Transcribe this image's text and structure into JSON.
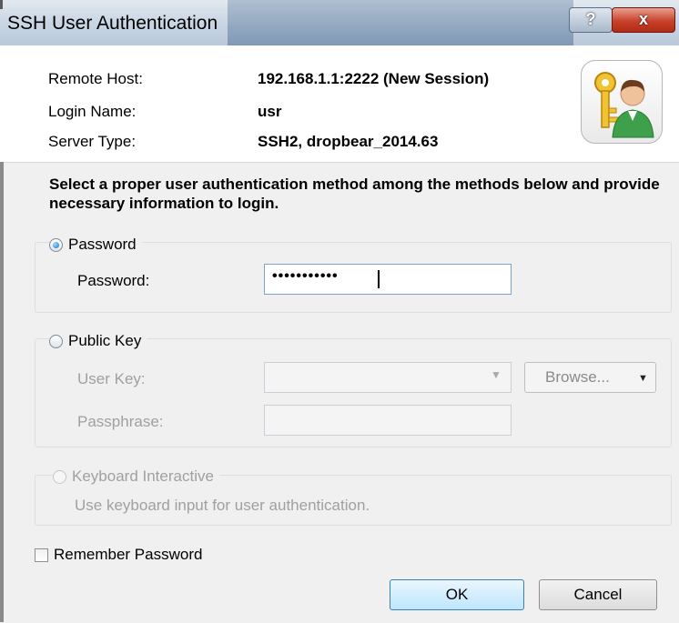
{
  "window": {
    "title": "SSH User Authentication",
    "help_label": "?",
    "close_label": "x"
  },
  "info": {
    "remote_host_label": "Remote Host:",
    "remote_host_value": "192.168.1.1:2222 (New Session)",
    "login_name_label": "Login Name:",
    "login_name_value": "usr",
    "server_type_label": "Server Type:",
    "server_type_value": "SSH2, dropbear_2014.63",
    "avatar_icon": "user-key-icon"
  },
  "instruction": "Select a proper user authentication method among the methods below and provide necessary information to login.",
  "password_method": {
    "label": "Password",
    "selected": true,
    "field_label": "Password:",
    "field_value": "•••••••••••"
  },
  "public_key_method": {
    "label": "Public Key",
    "selected": false,
    "user_key_label": "User Key:",
    "user_key_value": "",
    "browse_label": "Browse...",
    "passphrase_label": "Passphrase:",
    "passphrase_value": ""
  },
  "keyboard_interactive_method": {
    "label": "Keyboard Interactive",
    "selected": false,
    "enabled": false,
    "description": "Use keyboard input for user authentication."
  },
  "remember_password": {
    "label": "Remember Password",
    "checked": false
  },
  "buttons": {
    "ok_label": "OK",
    "cancel_label": "Cancel"
  },
  "colors": {
    "titlebar": "#c9d6e4",
    "body_bg": "#f0f0f0",
    "close_red": "#c8412a",
    "default_button_blue": "#bee6fd",
    "disabled_text": "#a0a0a0"
  }
}
